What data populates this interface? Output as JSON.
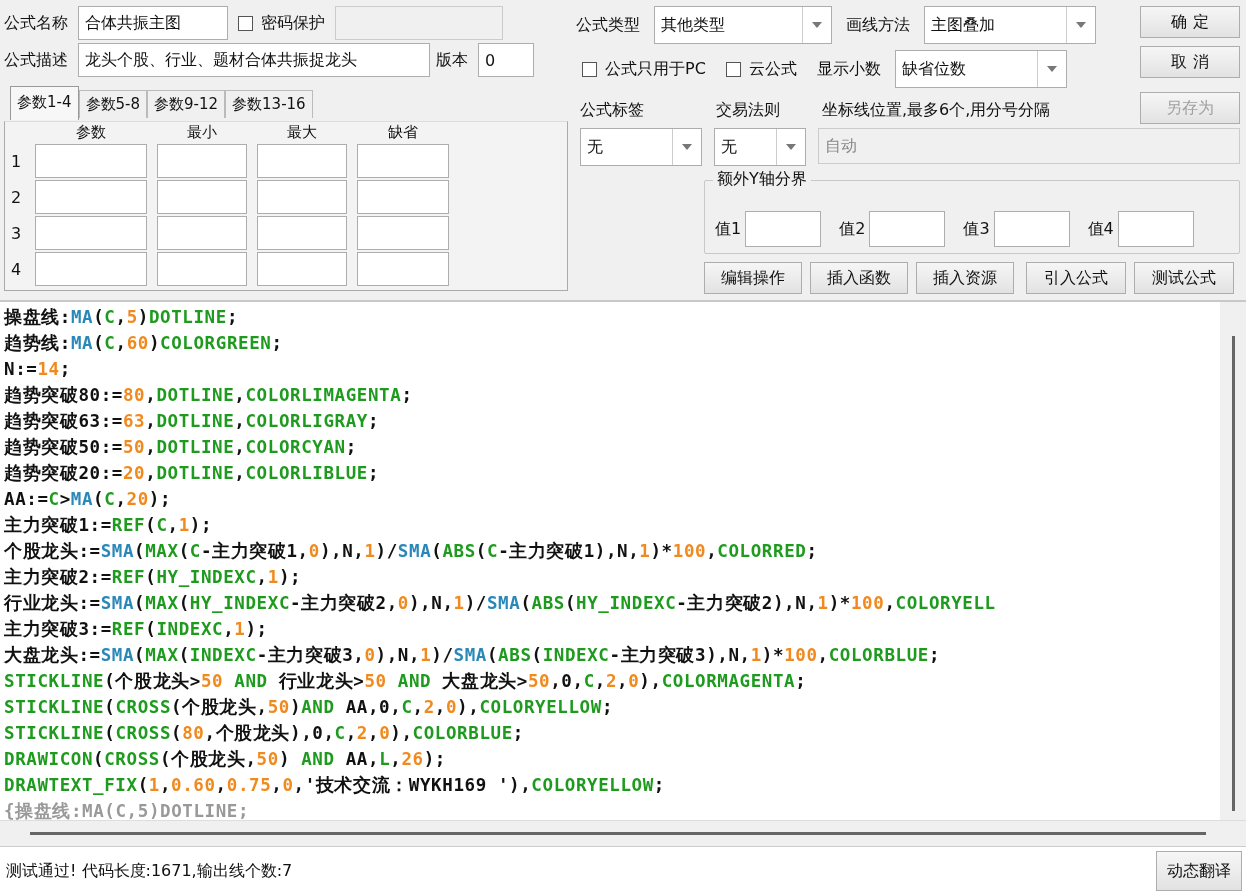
{
  "name_field": {
    "label": "公式名称",
    "value": "合体共振主图"
  },
  "password_protect": {
    "label": "密码保护",
    "checked": false,
    "field_disabled": true
  },
  "description_field": {
    "label": "公式描述",
    "value": "龙头个股、行业、题材合体共振捉龙头"
  },
  "version_field": {
    "label": "版本",
    "value": "0"
  },
  "param_tabs": [
    {
      "label": "参数1-4",
      "selected": true
    },
    {
      "label": "参数5-8",
      "selected": false
    },
    {
      "label": "参数9-12",
      "selected": false
    },
    {
      "label": "参数13-16",
      "selected": false
    }
  ],
  "param_columns": [
    "参数",
    "最小",
    "最大",
    "缺省"
  ],
  "param_rows": [
    "1",
    "2",
    "3",
    "4"
  ],
  "formula_type": {
    "label": "公式类型",
    "value": "其他类型"
  },
  "draw_method": {
    "label": "画线方法",
    "value": "主图叠加"
  },
  "options": [
    {
      "label": "公式只用于PC",
      "checked": false
    },
    {
      "label": "云公式",
      "checked": false
    }
  ],
  "decimals": {
    "label": "显示小数",
    "value": "缺省位数"
  },
  "side_buttons": [
    {
      "label": "确 定",
      "disabled": false
    },
    {
      "label": "取 消",
      "disabled": false
    },
    {
      "label": "另存为",
      "disabled": true
    }
  ],
  "formula_tag": {
    "label": "公式标签",
    "value": "无"
  },
  "trade_rule": {
    "label": "交易法则",
    "value": "无"
  },
  "axis_lines": {
    "label": "坐标线位置,最多6个,用分号分隔",
    "value": "自动",
    "disabled": true
  },
  "extra_y": {
    "title": "额外Y轴分界",
    "fields": [
      "值1",
      "值2",
      "值3",
      "值4"
    ]
  },
  "action_buttons": [
    "编辑操作",
    "插入函数",
    "插入资源",
    "引入公式",
    "测试公式"
  ],
  "code_lines": [
    [
      {
        "kind": "plain",
        "text": "操盘线:"
      },
      {
        "kind": "function",
        "text": "MA"
      },
      {
        "kind": "plain",
        "text": "("
      },
      {
        "kind": "keyword",
        "text": "C"
      },
      {
        "kind": "plain",
        "text": ","
      },
      {
        "kind": "number",
        "text": "5"
      },
      {
        "kind": "plain",
        "text": ")"
      },
      {
        "kind": "keyword",
        "text": "DOTLINE"
      },
      {
        "kind": "plain",
        "text": ";"
      }
    ],
    [
      {
        "kind": "plain",
        "text": "趋势线:"
      },
      {
        "kind": "function",
        "text": "MA"
      },
      {
        "kind": "plain",
        "text": "("
      },
      {
        "kind": "keyword",
        "text": "C"
      },
      {
        "kind": "plain",
        "text": ","
      },
      {
        "kind": "number",
        "text": "60"
      },
      {
        "kind": "plain",
        "text": ")"
      },
      {
        "kind": "keyword",
        "text": "COLORGREEN"
      },
      {
        "kind": "plain",
        "text": ";"
      }
    ],
    [
      {
        "kind": "plain",
        "text": "N:="
      },
      {
        "kind": "number",
        "text": "14"
      },
      {
        "kind": "plain",
        "text": ";"
      }
    ],
    [
      {
        "kind": "plain",
        "text": "趋势突破80:="
      },
      {
        "kind": "number",
        "text": "80"
      },
      {
        "kind": "plain",
        "text": ","
      },
      {
        "kind": "keyword",
        "text": "DOTLINE"
      },
      {
        "kind": "plain",
        "text": ","
      },
      {
        "kind": "keyword",
        "text": "COLORLIMAGENTA"
      },
      {
        "kind": "plain",
        "text": ";"
      }
    ],
    [
      {
        "kind": "plain",
        "text": "趋势突破63:="
      },
      {
        "kind": "number",
        "text": "63"
      },
      {
        "kind": "plain",
        "text": ","
      },
      {
        "kind": "keyword",
        "text": "DOTLINE"
      },
      {
        "kind": "plain",
        "text": ","
      },
      {
        "kind": "keyword",
        "text": "COLORLIGRAY"
      },
      {
        "kind": "plain",
        "text": ";"
      }
    ],
    [
      {
        "kind": "plain",
        "text": "趋势突破50:="
      },
      {
        "kind": "number",
        "text": "50"
      },
      {
        "kind": "plain",
        "text": ","
      },
      {
        "kind": "keyword",
        "text": "DOTLINE"
      },
      {
        "kind": "plain",
        "text": ","
      },
      {
        "kind": "keyword",
        "text": "COLORCYAN"
      },
      {
        "kind": "plain",
        "text": ";"
      }
    ],
    [
      {
        "kind": "plain",
        "text": "趋势突破20:="
      },
      {
        "kind": "number",
        "text": "20"
      },
      {
        "kind": "plain",
        "text": ","
      },
      {
        "kind": "keyword",
        "text": "DOTLINE"
      },
      {
        "kind": "plain",
        "text": ","
      },
      {
        "kind": "keyword",
        "text": "COLORLIBLUE"
      },
      {
        "kind": "plain",
        "text": ";"
      }
    ],
    [
      {
        "kind": "plain",
        "text": "AA:="
      },
      {
        "kind": "keyword",
        "text": "C"
      },
      {
        "kind": "plain",
        "text": ">"
      },
      {
        "kind": "function",
        "text": "MA"
      },
      {
        "kind": "plain",
        "text": "("
      },
      {
        "kind": "keyword",
        "text": "C"
      },
      {
        "kind": "plain",
        "text": ","
      },
      {
        "kind": "number",
        "text": "20"
      },
      {
        "kind": "plain",
        "text": ");"
      }
    ],
    [
      {
        "kind": "plain",
        "text": "主力突破1:="
      },
      {
        "kind": "keyword",
        "text": "REF"
      },
      {
        "kind": "plain",
        "text": "("
      },
      {
        "kind": "keyword",
        "text": "C"
      },
      {
        "kind": "plain",
        "text": ","
      },
      {
        "kind": "number",
        "text": "1"
      },
      {
        "kind": "plain",
        "text": ");"
      }
    ],
    [
      {
        "kind": "plain",
        "text": "个股龙头:="
      },
      {
        "kind": "function",
        "text": "SMA"
      },
      {
        "kind": "plain",
        "text": "("
      },
      {
        "kind": "keyword",
        "text": "MAX"
      },
      {
        "kind": "plain",
        "text": "("
      },
      {
        "kind": "keyword",
        "text": "C"
      },
      {
        "kind": "plain",
        "text": "-主力突破1,"
      },
      {
        "kind": "number",
        "text": "0"
      },
      {
        "kind": "plain",
        "text": "),N,"
      },
      {
        "kind": "number",
        "text": "1"
      },
      {
        "kind": "plain",
        "text": ")/"
      },
      {
        "kind": "function",
        "text": "SMA"
      },
      {
        "kind": "plain",
        "text": "("
      },
      {
        "kind": "keyword",
        "text": "ABS"
      },
      {
        "kind": "plain",
        "text": "("
      },
      {
        "kind": "keyword",
        "text": "C"
      },
      {
        "kind": "plain",
        "text": "-主力突破1),N,"
      },
      {
        "kind": "number",
        "text": "1"
      },
      {
        "kind": "plain",
        "text": ")*"
      },
      {
        "kind": "number",
        "text": "100"
      },
      {
        "kind": "plain",
        "text": ","
      },
      {
        "kind": "keyword",
        "text": "COLORRED"
      },
      {
        "kind": "plain",
        "text": ";"
      }
    ],
    [
      {
        "kind": "plain",
        "text": "主力突破2:="
      },
      {
        "kind": "keyword",
        "text": "REF"
      },
      {
        "kind": "plain",
        "text": "("
      },
      {
        "kind": "keyword",
        "text": "HY_INDEXC"
      },
      {
        "kind": "plain",
        "text": ","
      },
      {
        "kind": "number",
        "text": "1"
      },
      {
        "kind": "plain",
        "text": ");"
      }
    ],
    [
      {
        "kind": "plain",
        "text": "行业龙头:="
      },
      {
        "kind": "function",
        "text": "SMA"
      },
      {
        "kind": "plain",
        "text": "("
      },
      {
        "kind": "keyword",
        "text": "MAX"
      },
      {
        "kind": "plain",
        "text": "("
      },
      {
        "kind": "keyword",
        "text": "HY_INDEXC"
      },
      {
        "kind": "plain",
        "text": "-主力突破2,"
      },
      {
        "kind": "number",
        "text": "0"
      },
      {
        "kind": "plain",
        "text": "),N,"
      },
      {
        "kind": "number",
        "text": "1"
      },
      {
        "kind": "plain",
        "text": ")/"
      },
      {
        "kind": "function",
        "text": "SMA"
      },
      {
        "kind": "plain",
        "text": "("
      },
      {
        "kind": "keyword",
        "text": "ABS"
      },
      {
        "kind": "plain",
        "text": "("
      },
      {
        "kind": "keyword",
        "text": "HY_INDEXC"
      },
      {
        "kind": "plain",
        "text": "-主力突破2),N,"
      },
      {
        "kind": "number",
        "text": "1"
      },
      {
        "kind": "plain",
        "text": ")*"
      },
      {
        "kind": "number",
        "text": "100"
      },
      {
        "kind": "plain",
        "text": ","
      },
      {
        "kind": "keyword",
        "text": "COLORYELL"
      }
    ],
    [
      {
        "kind": "plain",
        "text": "主力突破3:="
      },
      {
        "kind": "keyword",
        "text": "REF"
      },
      {
        "kind": "plain",
        "text": "("
      },
      {
        "kind": "keyword",
        "text": "INDEXC"
      },
      {
        "kind": "plain",
        "text": ","
      },
      {
        "kind": "number",
        "text": "1"
      },
      {
        "kind": "plain",
        "text": ");"
      }
    ],
    [
      {
        "kind": "plain",
        "text": "大盘龙头:="
      },
      {
        "kind": "function",
        "text": "SMA"
      },
      {
        "kind": "plain",
        "text": "("
      },
      {
        "kind": "keyword",
        "text": "MAX"
      },
      {
        "kind": "plain",
        "text": "("
      },
      {
        "kind": "keyword",
        "text": "INDEXC"
      },
      {
        "kind": "plain",
        "text": "-主力突破3,"
      },
      {
        "kind": "number",
        "text": "0"
      },
      {
        "kind": "plain",
        "text": "),N,"
      },
      {
        "kind": "number",
        "text": "1"
      },
      {
        "kind": "plain",
        "text": ")/"
      },
      {
        "kind": "function",
        "text": "SMA"
      },
      {
        "kind": "plain",
        "text": "("
      },
      {
        "kind": "keyword",
        "text": "ABS"
      },
      {
        "kind": "plain",
        "text": "("
      },
      {
        "kind": "keyword",
        "text": "INDEXC"
      },
      {
        "kind": "plain",
        "text": "-主力突破3),N,"
      },
      {
        "kind": "number",
        "text": "1"
      },
      {
        "kind": "plain",
        "text": ")*"
      },
      {
        "kind": "number",
        "text": "100"
      },
      {
        "kind": "plain",
        "text": ","
      },
      {
        "kind": "keyword",
        "text": "COLORBLUE"
      },
      {
        "kind": "plain",
        "text": ";"
      }
    ],
    [
      {
        "kind": "keyword",
        "text": "STICKLINE"
      },
      {
        "kind": "plain",
        "text": "(个股龙头>"
      },
      {
        "kind": "number",
        "text": "50"
      },
      {
        "kind": "keyword",
        "text": " AND "
      },
      {
        "kind": "plain",
        "text": "行业龙头>"
      },
      {
        "kind": "number",
        "text": "50"
      },
      {
        "kind": "keyword",
        "text": " AND "
      },
      {
        "kind": "plain",
        "text": "大盘龙头>"
      },
      {
        "kind": "number",
        "text": "50"
      },
      {
        "kind": "plain",
        "text": ",0,"
      },
      {
        "kind": "keyword",
        "text": "C"
      },
      {
        "kind": "plain",
        "text": ","
      },
      {
        "kind": "number",
        "text": "2"
      },
      {
        "kind": "plain",
        "text": ","
      },
      {
        "kind": "number",
        "text": "0"
      },
      {
        "kind": "plain",
        "text": "),"
      },
      {
        "kind": "keyword",
        "text": "COLORMAGENTA"
      },
      {
        "kind": "plain",
        "text": ";"
      }
    ],
    [
      {
        "kind": "keyword",
        "text": "STICKLINE"
      },
      {
        "kind": "plain",
        "text": "("
      },
      {
        "kind": "keyword",
        "text": "CROSS"
      },
      {
        "kind": "plain",
        "text": "(个股龙头,"
      },
      {
        "kind": "number",
        "text": "50"
      },
      {
        "kind": "plain",
        "text": ")"
      },
      {
        "kind": "keyword",
        "text": "AND"
      },
      {
        "kind": "plain",
        "text": " AA,0,"
      },
      {
        "kind": "keyword",
        "text": "C"
      },
      {
        "kind": "plain",
        "text": ","
      },
      {
        "kind": "number",
        "text": "2"
      },
      {
        "kind": "plain",
        "text": ","
      },
      {
        "kind": "number",
        "text": "0"
      },
      {
        "kind": "plain",
        "text": "),"
      },
      {
        "kind": "keyword",
        "text": "COLORYELLOW"
      },
      {
        "kind": "plain",
        "text": ";"
      }
    ],
    [
      {
        "kind": "keyword",
        "text": "STICKLINE"
      },
      {
        "kind": "plain",
        "text": "("
      },
      {
        "kind": "keyword",
        "text": "CROSS"
      },
      {
        "kind": "plain",
        "text": "("
      },
      {
        "kind": "number",
        "text": "80"
      },
      {
        "kind": "plain",
        "text": ",个股龙头),0,"
      },
      {
        "kind": "keyword",
        "text": "C"
      },
      {
        "kind": "plain",
        "text": ","
      },
      {
        "kind": "number",
        "text": "2"
      },
      {
        "kind": "plain",
        "text": ","
      },
      {
        "kind": "number",
        "text": "0"
      },
      {
        "kind": "plain",
        "text": "),"
      },
      {
        "kind": "keyword",
        "text": "COLORBLUE"
      },
      {
        "kind": "plain",
        "text": ";"
      }
    ],
    [
      {
        "kind": "keyword",
        "text": "DRAWICON"
      },
      {
        "kind": "plain",
        "text": "("
      },
      {
        "kind": "keyword",
        "text": "CROSS"
      },
      {
        "kind": "plain",
        "text": "(个股龙头,"
      },
      {
        "kind": "number",
        "text": "50"
      },
      {
        "kind": "plain",
        "text": ")"
      },
      {
        "kind": "keyword",
        "text": " AND "
      },
      {
        "kind": "plain",
        "text": "AA,"
      },
      {
        "kind": "keyword",
        "text": "L"
      },
      {
        "kind": "plain",
        "text": ","
      },
      {
        "kind": "number",
        "text": "26"
      },
      {
        "kind": "plain",
        "text": ");"
      }
    ],
    [
      {
        "kind": "keyword",
        "text": "DRAWTEXT_FIX"
      },
      {
        "kind": "plain",
        "text": "("
      },
      {
        "kind": "number",
        "text": "1"
      },
      {
        "kind": "plain",
        "text": ","
      },
      {
        "kind": "number",
        "text": "0.60"
      },
      {
        "kind": "plain",
        "text": ","
      },
      {
        "kind": "number",
        "text": "0.75"
      },
      {
        "kind": "plain",
        "text": ","
      },
      {
        "kind": "number",
        "text": "0"
      },
      {
        "kind": "plain",
        "text": ",'技术交流：WYKH169 '),"
      },
      {
        "kind": "keyword",
        "text": "COLORYELLOW"
      },
      {
        "kind": "plain",
        "text": ";"
      }
    ],
    [
      {
        "kind": "comment",
        "text": "{操盘线:MA(C,5)DOTLINE;"
      }
    ]
  ],
  "status": {
    "message": "测试通过! 代码长度:1671,输出线个数:7",
    "button": "动态翻译"
  }
}
